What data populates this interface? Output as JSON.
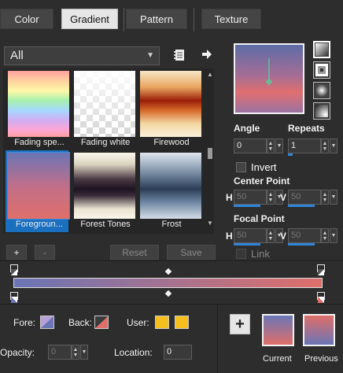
{
  "tabs": [
    {
      "label": "Color"
    },
    {
      "label": "Gradient"
    },
    {
      "label": "Pattern"
    },
    {
      "label": "Texture"
    }
  ],
  "category": {
    "value": "All"
  },
  "gallery": [
    {
      "label": "Fading spe..."
    },
    {
      "label": "Fading white"
    },
    {
      "label": "Firewood"
    },
    {
      "label": "Foregroun..."
    },
    {
      "label": "Forest Tones"
    },
    {
      "label": "Frost"
    }
  ],
  "actions": {
    "add": "+",
    "remove": "-",
    "reset": "Reset",
    "save": "Save"
  },
  "angle": {
    "label": "Angle",
    "value": "0"
  },
  "repeats": {
    "label": "Repeats",
    "value": "1"
  },
  "invert": {
    "label": "Invert"
  },
  "center_point": {
    "label": "Center Point",
    "h_label": "H",
    "h_value": "50",
    "v_label": "V",
    "v_value": "50"
  },
  "focal_point": {
    "label": "Focal Point",
    "h_label": "H",
    "h_value": "50",
    "v_label": "V",
    "v_value": "50"
  },
  "link": {
    "label": "Link"
  },
  "bottom": {
    "fore_label": "Fore:",
    "back_label": "Back:",
    "user_label": "User:",
    "opacity_label": "Opacity:",
    "opacity_value": "0",
    "location_label": "Location:",
    "location_value": "0",
    "add_symbol": "+",
    "current_label": "Current",
    "previous_label": "Previous"
  },
  "colors": {
    "background": "#2d2d2d",
    "accent": "#2f86d8",
    "gradient_start": "#6a75b5",
    "gradient_end": "#e06f6a",
    "user_swatch": "#f5c01e"
  }
}
